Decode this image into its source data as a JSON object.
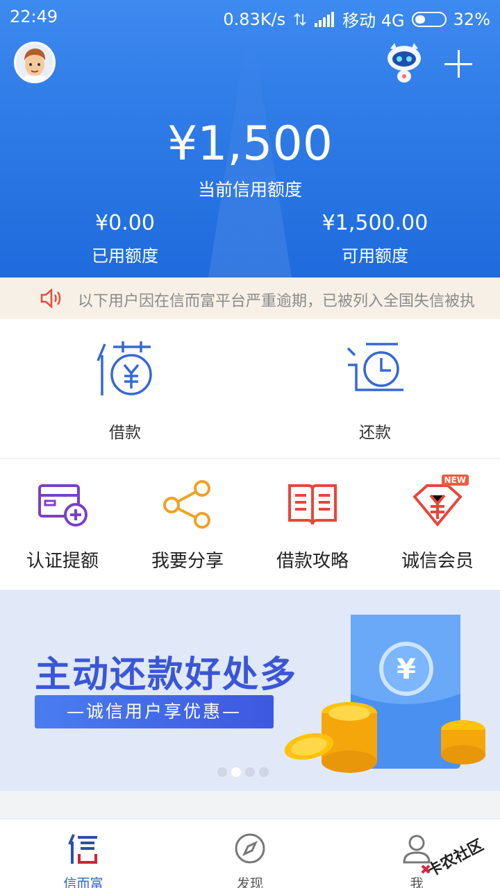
{
  "status_bar": {
    "time": "22:49",
    "speed": "0.83K/s",
    "carrier": "移动 4G",
    "battery": "32%"
  },
  "credit": {
    "amount": "¥1,500",
    "amount_label": "当前信用额度",
    "used_amount": "¥0.00",
    "used_label": "已用额度",
    "available_amount": "¥1,500.00",
    "available_label": "可用额度"
  },
  "notice": {
    "text": "以下用户因在信而富平台严重逾期，已被列入全国失信被执"
  },
  "main_actions": [
    {
      "label": "借款",
      "icon": "borrow-icon"
    },
    {
      "label": "还款",
      "icon": "repay-clock-icon"
    }
  ],
  "features": [
    {
      "label": "认证提额",
      "icon": "card-plus-icon",
      "color": "#7a3fc8"
    },
    {
      "label": "我要分享",
      "icon": "share-icon",
      "color": "#f0a124"
    },
    {
      "label": "借款攻略",
      "icon": "book-icon",
      "color": "#e8463a"
    },
    {
      "label": "诚信会员",
      "icon": "yen-diamond-icon",
      "color": "#e8463a",
      "badge": "NEW"
    }
  ],
  "banner": {
    "title": "主动还款好处多",
    "subtitle": "—诚信用户享优惠—",
    "page": 2,
    "page_count": 4
  },
  "bottom_nav": [
    {
      "label": "信而富",
      "active": true
    },
    {
      "label": "发现",
      "active": false
    },
    {
      "label": "我",
      "active": false
    }
  ],
  "watermark": "卡农社区",
  "colors": {
    "header": "#2e7ae6",
    "accent": "#2c63c8",
    "notice_bg": "#f7f0e6"
  }
}
